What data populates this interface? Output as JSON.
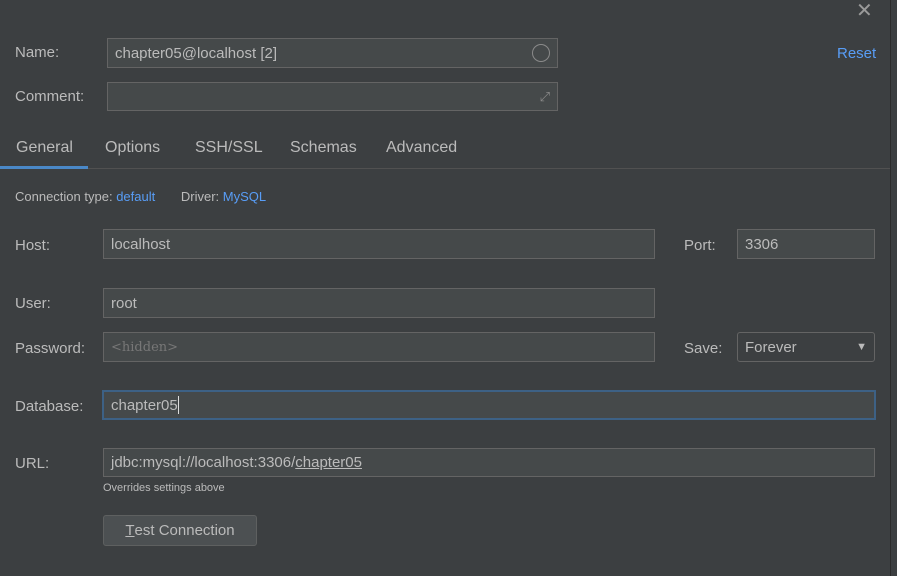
{
  "close_icon": "x-icon",
  "name": {
    "label": "Name:",
    "value": "chapter05@localhost [2]"
  },
  "comment": {
    "label": "Comment:",
    "value": ""
  },
  "reset_label": "Reset",
  "tabs": [
    {
      "label": "General",
      "active": true
    },
    {
      "label": "Options"
    },
    {
      "label": "SSH/SSL"
    },
    {
      "label": "Schemas"
    },
    {
      "label": "Advanced"
    }
  ],
  "connection_type": {
    "label": "Connection type:",
    "value": "default"
  },
  "driver": {
    "label": "Driver:",
    "value": "MySQL"
  },
  "host": {
    "label": "Host:",
    "value": "localhost"
  },
  "port": {
    "label": "Port:",
    "value": "3306"
  },
  "user": {
    "label": "User:",
    "value": "root"
  },
  "password": {
    "label": "Password:",
    "placeholder": "<hidden>"
  },
  "save": {
    "label": "Save:",
    "value": "Forever"
  },
  "database": {
    "label": "Database:",
    "value": "chapter05"
  },
  "url": {
    "label": "URL:",
    "prefix": "jdbc:mysql://localhost:3306/",
    "db": "chapter05",
    "hint": "Overrides settings above"
  },
  "test_connection": {
    "mnemonic": "T",
    "rest": "est Connection"
  },
  "colors": {
    "background": "#3c3f41",
    "accent": "#589df6",
    "focus": "#3d6185",
    "tab_underline": "#4a88c7"
  }
}
